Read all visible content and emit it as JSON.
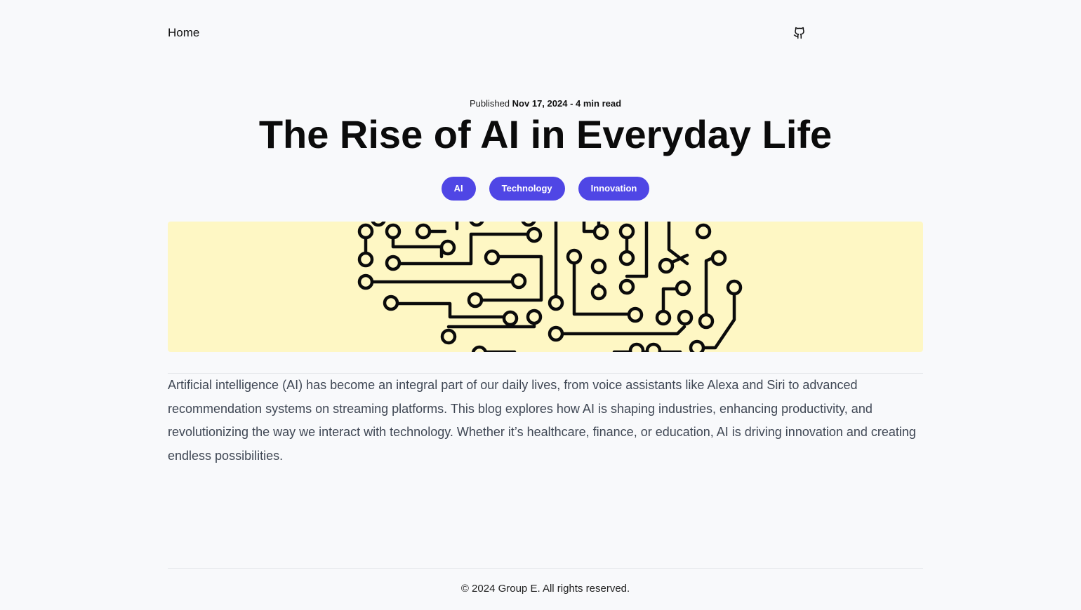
{
  "nav": {
    "home_label": "Home",
    "github_icon": "github-icon"
  },
  "post": {
    "published_prefix": "Published",
    "date": "Nov 17, 2024",
    "separator": " - ",
    "read_time": "4 min read",
    "title": "The Rise of AI in Everyday Life",
    "tags": [
      "AI",
      "Technology",
      "Innovation"
    ],
    "hero_image": "circuit-board-illustration",
    "body": "Artificial intelligence (AI) has become an integral part of our daily lives, from voice assistants like Alexa and Siri to advanced recommendation systems on streaming platforms. This blog explores how AI is shaping industries, enhancing productivity, and revolutionizing the way we interact with technology. Whether it’s healthcare, finance, or education, AI is driving innovation and creating endless possibilities."
  },
  "footer": {
    "text": "© 2024 Group E. All rights reserved."
  },
  "colors": {
    "tag_bg": "#4f46e5",
    "hero_bg": "#fef7c4",
    "page_bg": "#f8f9fb"
  }
}
